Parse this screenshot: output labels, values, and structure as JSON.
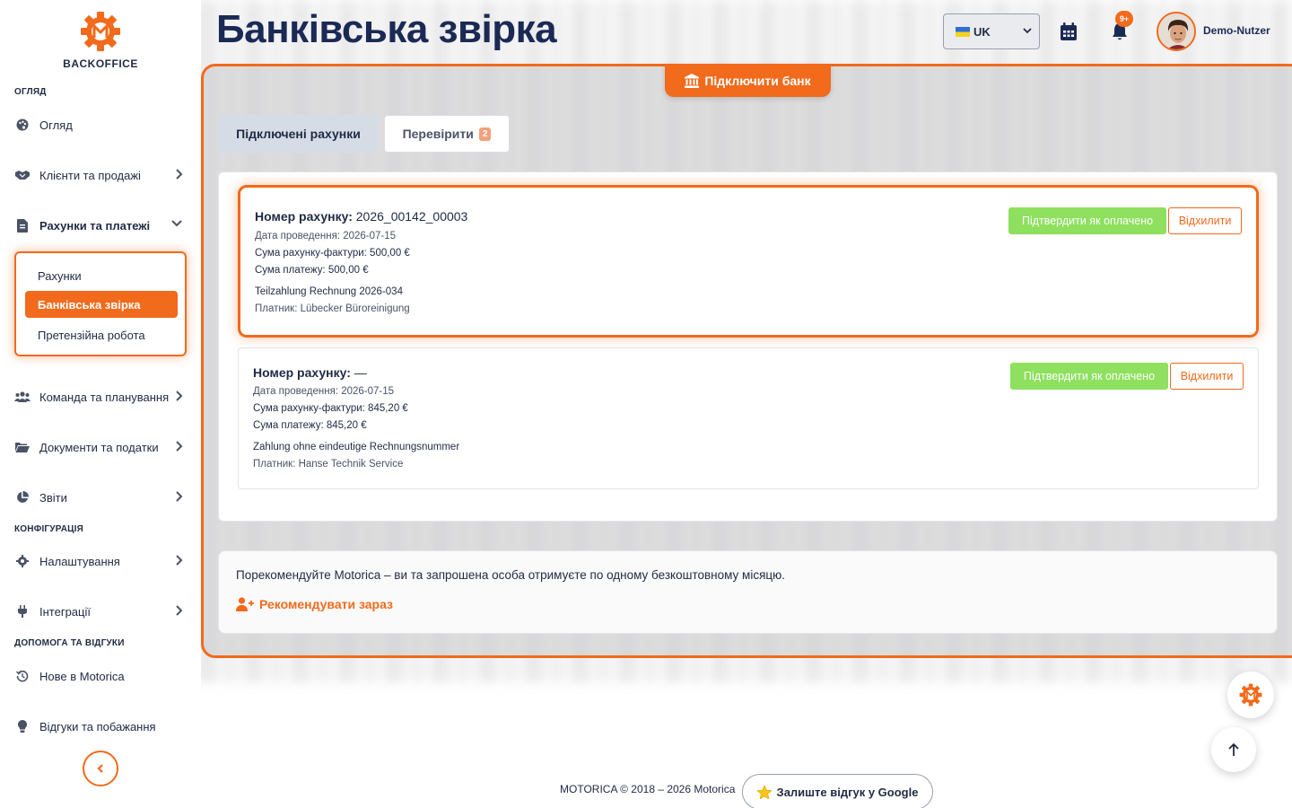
{
  "brand": {
    "logo_text": "BACKOFFICE",
    "accent_color": "#f26a1b"
  },
  "header": {
    "title": "Банківська звірка",
    "language": "UK",
    "notifications_badge": "9+",
    "user_name": "Demo-Nutzer"
  },
  "sidebar": {
    "sections": {
      "overview": "ОГЛЯД",
      "configuration": "КОНФІГУРАЦІЯ",
      "help": "ДОПОМОГА ТА ВІДГУКИ"
    },
    "items": {
      "overview": "Огляд",
      "clients": "Клієнти та продажі",
      "invoices_payments": "Рахунки та платежі",
      "team": "Команда та планування",
      "documents": "Документи та податки",
      "reports": "Звіти",
      "settings": "Налаштування",
      "integrations": "Інтеграції",
      "news": "Нове в Motorica",
      "feedback": "Відгуки та побажання"
    },
    "submenu": {
      "invoices": "Рахунки",
      "bank_reconciliation": "Банківська звірка",
      "claims": "Претензійна робота"
    }
  },
  "main": {
    "connect_bank": "Підключити банк",
    "tabs": {
      "connected": "Підключені рахунки",
      "check": "Перевірити",
      "check_count": "2"
    },
    "transactions": [
      {
        "invoice_label": "Номер рахунку:",
        "invoice_number": "2026_00142_00003",
        "posting_date": "Дата проведення: 2026-07-15",
        "invoice_amount": "Сума рахунку-фактури: 500,00 €",
        "payment_amount": "Сума платежу: 500,00 €",
        "reference": "Teilzahlung Rechnung 2026-034",
        "payer": "Платник: Lübecker Büroreinigung",
        "confirm_label": "Підтвердити як оплачено",
        "reject_label": "Відхилити"
      },
      {
        "invoice_label": "Номер рахунку:",
        "invoice_number": "—",
        "posting_date": "Дата проведення: 2026-07-15",
        "invoice_amount": "Сума рахунку-фактури: 845,20 €",
        "payment_amount": "Сума платежу: 845,20 €",
        "reference": "Zahlung ohne eindeutige Rechnungsnummer",
        "payer": "Платник: Hanse Technik Service",
        "confirm_label": "Підтвердити як оплачено",
        "reject_label": "Відхилити"
      }
    ],
    "referral": {
      "text": "Порекомендуйте Motorica – ви та запрошена особа отримуєте по одному безкоштовному місяцю.",
      "link": "Рекомендувати зараз"
    }
  },
  "footer": {
    "copyright": "MOTORICA © 2018 – 2026 Motorica",
    "google_review": "Залиште відгук у Google"
  }
}
